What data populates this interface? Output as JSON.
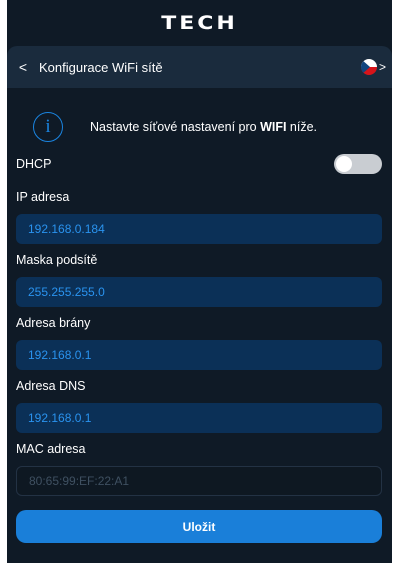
{
  "brand": {
    "logo_text": "TECH"
  },
  "header": {
    "back_icon": "chevron-left-icon",
    "title": "Konfigurace WiFi sítě",
    "language": "cs",
    "language_chevron": "chevron-right-icon"
  },
  "info": {
    "icon": "info-icon",
    "message_pre": "Nastavte síťové nastavení pro ",
    "message_bold": "WIFI",
    "message_post": " níže."
  },
  "dhcp": {
    "label": "DHCP",
    "enabled": false
  },
  "fields": {
    "ip": {
      "label": "IP adresa",
      "value": "192.168.0.184"
    },
    "mask": {
      "label": "Maska podsítě",
      "value": "255.255.255.0"
    },
    "gateway": {
      "label": "Adresa brány",
      "value": "192.168.0.1"
    },
    "dns": {
      "label": "Adresa DNS",
      "value": "192.168.0.1"
    },
    "mac": {
      "label": "MAC adresa",
      "value": "80:65:99:EF:22:A1"
    }
  },
  "save_label": "Uložit",
  "colors": {
    "background": "#0f1a26",
    "header": "#1a2b3d",
    "accent": "#1a7fd9",
    "input_bg": "#0b3057",
    "input_text": "#2a93ef"
  }
}
